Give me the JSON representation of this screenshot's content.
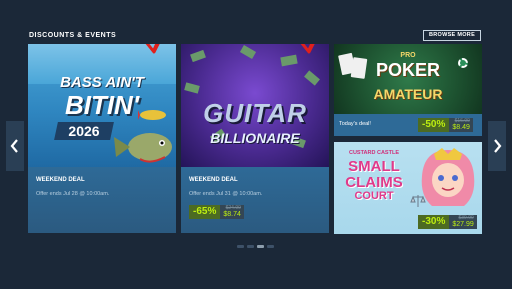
{
  "section": {
    "title": "DISCOUNTS & EVENTS",
    "browse_more": "BROWSE MORE"
  },
  "cards": [
    {
      "art_title_line1": "BASS AIN'T",
      "art_title_line2": "BITIN'",
      "art_year": "2026",
      "deal_type": "WEEKEND DEAL",
      "offer_ends": "Offer ends Jul 28 @ 10:00am."
    },
    {
      "art_title_line1": "GUITAR",
      "art_title_line2": "BILLIONAIRE",
      "deal_type": "WEEKEND DEAL",
      "offer_ends": "Offer ends Jul 31 @ 10:00am.",
      "discount": "-65%",
      "original_price": "$24.99",
      "final_price": "$8.74"
    },
    {
      "art_title_line1": "PRO",
      "art_title_line2": "POKER",
      "art_title_line3": "AMATEUR",
      "label": "Today's deal!",
      "discount": "-50%",
      "original_price": "$16.99",
      "final_price": "$8.49"
    },
    {
      "art_title_line1": "CUSTARD CASTLE",
      "art_title_line2": "SMALL",
      "art_title_line3": "CLAIMS",
      "art_title_line4": "COURT",
      "discount": "-30%",
      "original_price": "$39.99",
      "final_price": "$27.99"
    }
  ],
  "pagination": {
    "total": 4,
    "active_index": 2
  },
  "colors": {
    "background": "#1b2838",
    "discount_bg": "#4c6b22",
    "discount_text": "#beee11",
    "annotation_arrow": "#e0201c"
  }
}
